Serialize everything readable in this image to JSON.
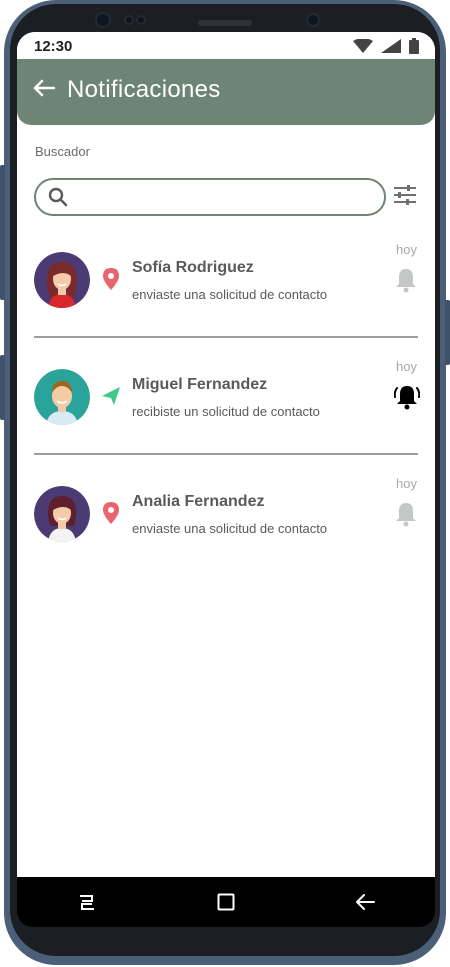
{
  "status_bar": {
    "time": "12:30",
    "icons": [
      "wifi-icon",
      "signal-icon",
      "battery-icon"
    ]
  },
  "header": {
    "title": "Notificaciones",
    "back_icon": "arrow-left-icon",
    "background_color": "#6e8474"
  },
  "search": {
    "label": "Buscador",
    "value": "",
    "placeholder": "",
    "filter_icon": "sliders-icon"
  },
  "notifications": [
    {
      "name": "Sofía Rodriguez",
      "message": "enviaste una solicitud de contacto",
      "time": "hoy",
      "type_icon": "location-pin-icon",
      "type_color": "#e8646f",
      "bell_active": false,
      "avatar_bg": "#4b3a73"
    },
    {
      "name": "Miguel Fernandez",
      "message": "recibiste un solicitud de contacto",
      "time": "hoy",
      "type_icon": "send-arrow-icon",
      "type_color": "#3ec98a",
      "bell_active": true,
      "avatar_bg": "#2aa39a"
    },
    {
      "name": "Analia Fernandez",
      "message": "enviaste una solicitud de contacto",
      "time": "hoy",
      "type_icon": "location-pin-icon",
      "type_color": "#e8646f",
      "bell_active": false,
      "avatar_bg": "#4b3a73"
    }
  ],
  "nav_bar": {
    "icons": [
      "recent-apps-icon",
      "home-icon",
      "back-icon"
    ]
  }
}
